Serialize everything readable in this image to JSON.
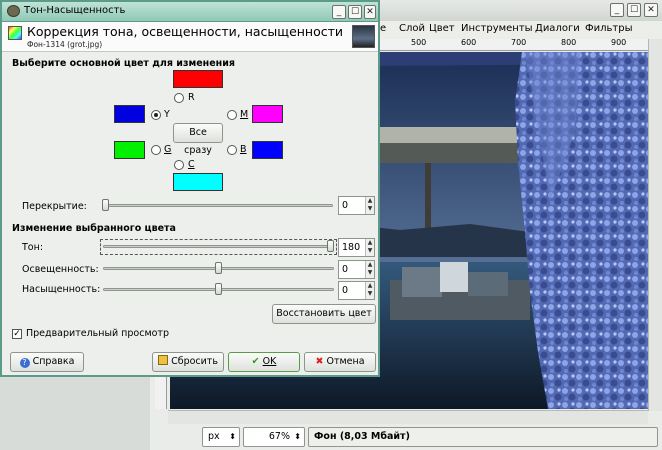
{
  "main_window": {
    "menu": [
      "Слой",
      "Цвет",
      "Инструменты",
      "Диалоги",
      "Фильтры"
    ],
    "partial_menu": "е",
    "window_buttons": {
      "minimize": "_",
      "maximize": "☐",
      "close": "✕"
    },
    "ruler_labels": [
      "500",
      "600",
      "700",
      "800",
      "900"
    ],
    "status": {
      "unit": "px",
      "zoom": "67%",
      "info": "Фон (8,03 Мбайт)"
    }
  },
  "dialog": {
    "title": "Тон-Насыщенность",
    "window_buttons": {
      "minimize": "_",
      "maximize": "☐",
      "close": "✕"
    },
    "header_title": "Коррекция тона, освещенности, насыщенности",
    "header_subtitle": "Фон-1314 (grot.jpg)",
    "section_primary": "Выберите основной цвет для изменения",
    "colors": {
      "R": "#ff0000",
      "Y": "#0000e0",
      "M": "#ff00ff",
      "G": "#00f000",
      "B": "#0000ff",
      "C": "#00ffff"
    },
    "labels": {
      "R": "R",
      "Y": "Y",
      "M": "M",
      "G": "G",
      "B": "B",
      "C": "C"
    },
    "selected": "Y",
    "all_button": "Все сразу",
    "overlap_label": "Перекрытие:",
    "overlap_value": "0",
    "overlap_level": 0,
    "section_adjust": "Изменение выбранного цвета",
    "hue_label": "Тон:",
    "hue_value": "180",
    "hue_level": 1.0,
    "lightness_label": "Освещенность:",
    "lightness_value": "0",
    "lightness_level": 0.5,
    "saturation_label": "Насыщенность:",
    "saturation_value": "0",
    "saturation_level": 0.5,
    "reset_color_button": "Восстановить цвет",
    "preview_label": "Предварительный просмотр",
    "preview_checked": true,
    "help_button": "Справка",
    "reset_button": "Сбросить",
    "ok_button": "OK",
    "cancel_button": "Отмена"
  }
}
